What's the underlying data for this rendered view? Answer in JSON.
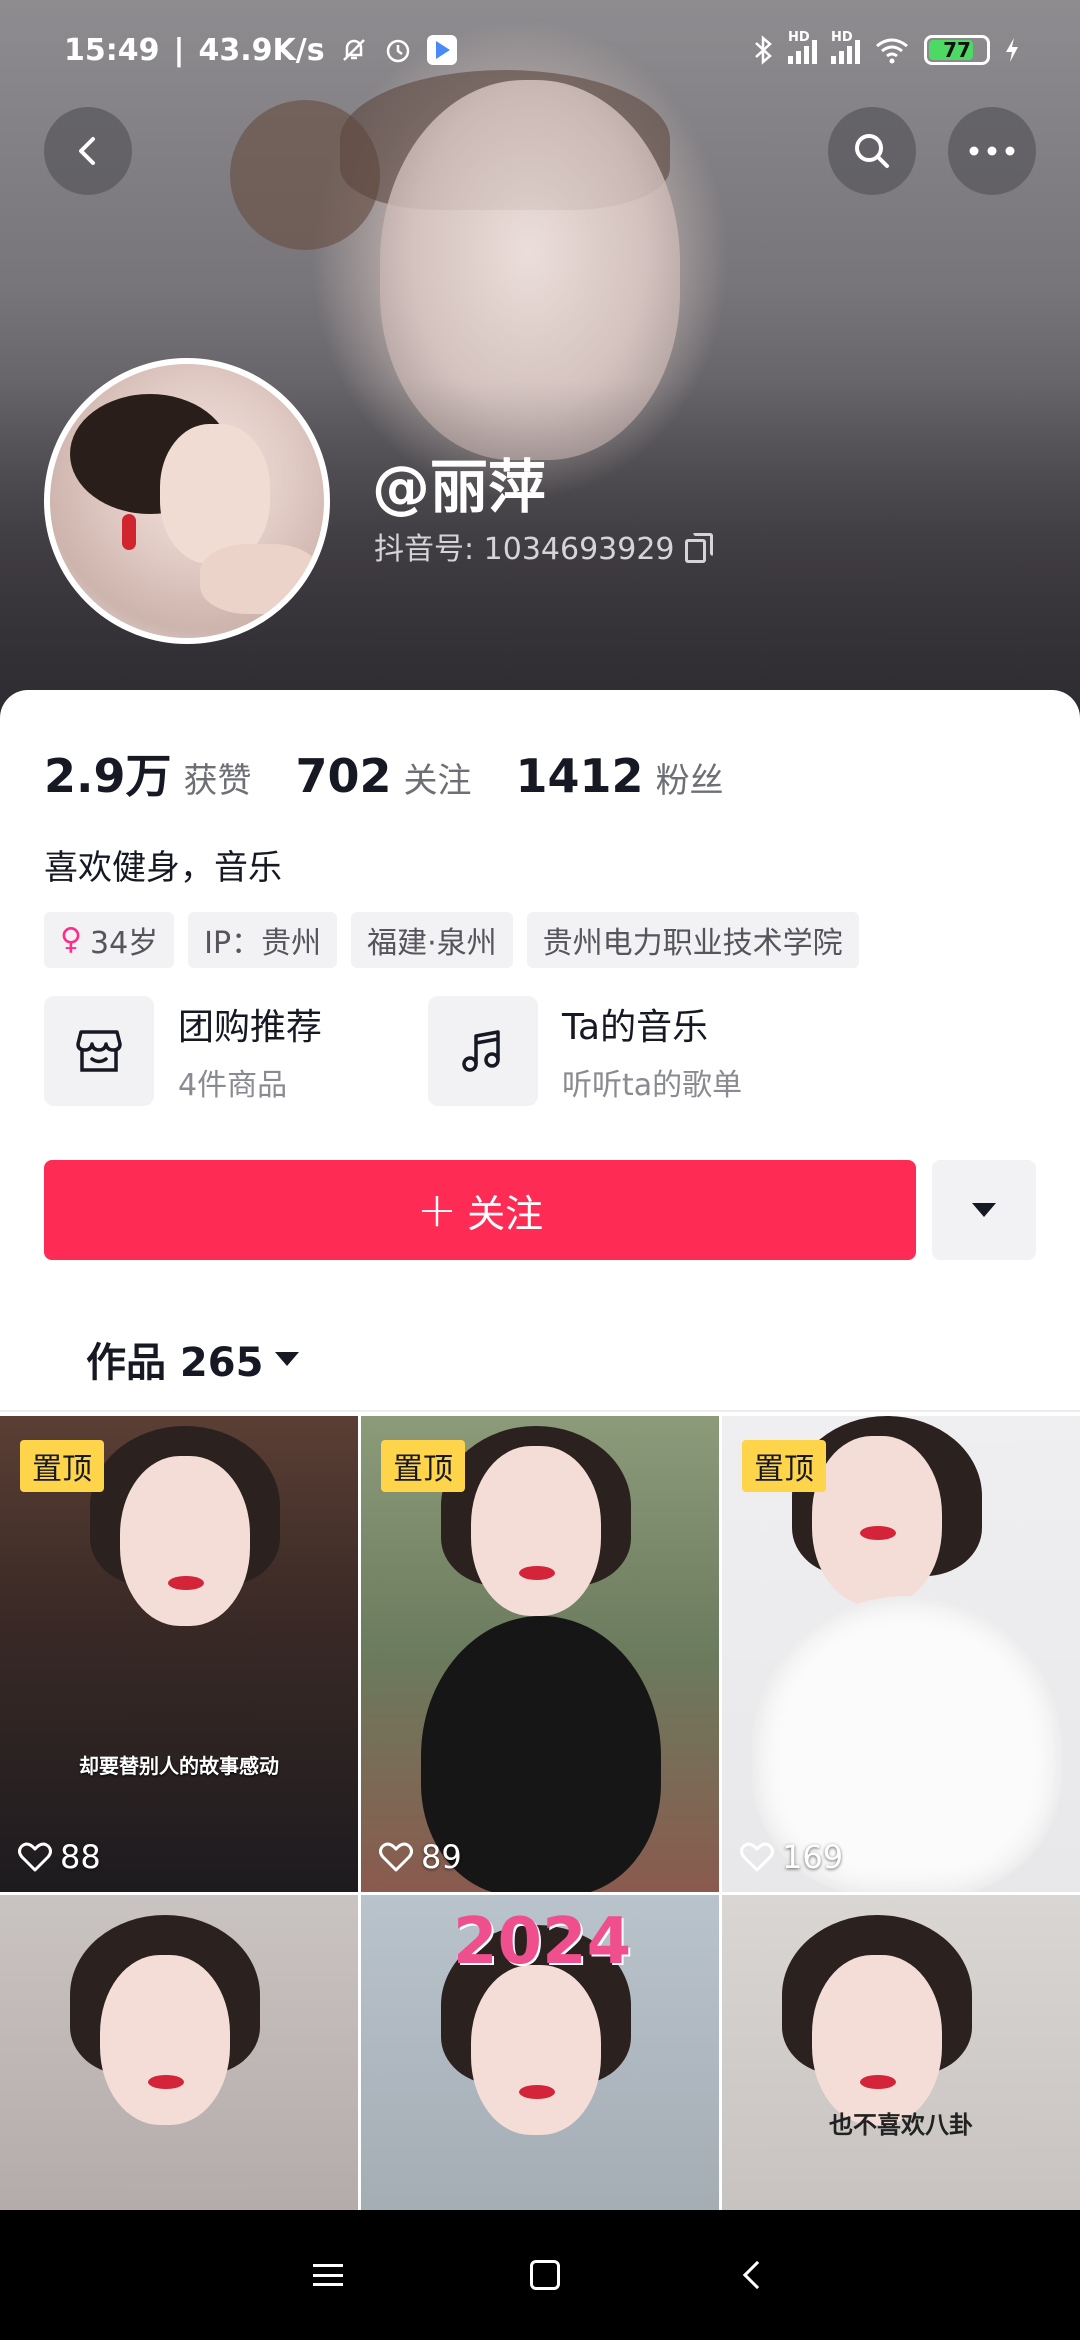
{
  "status_bar": {
    "time": "15:49",
    "net_speed": "43.9K/s",
    "battery": "77",
    "signal_label_1": "HD",
    "signal_label_2": "HD"
  },
  "profile": {
    "username": "@丽萍",
    "douyin_id": "抖音号: 1034693929"
  },
  "stats": [
    {
      "value": "2.9万",
      "label": "获赞"
    },
    {
      "value": "702",
      "label": "关注"
    },
    {
      "value": "1412",
      "label": "粉丝"
    }
  ],
  "bio": "喜欢健身，音乐",
  "tags": {
    "age": "34岁",
    "ip": "IP：贵州",
    "location": "福建·泉州",
    "school": "贵州电力职业技术学院"
  },
  "shortcuts": [
    {
      "title": "团购推荐",
      "subtitle": "4件商品",
      "icon": "shop-icon"
    },
    {
      "title": "Ta的音乐",
      "subtitle": "听听ta的歌单",
      "icon": "music-note-icon"
    }
  ],
  "follow_button": {
    "plus": "+",
    "label": "关注"
  },
  "works_tab": {
    "label": "作品 265"
  },
  "videos": [
    {
      "pinned_label": "置顶",
      "likes": "88",
      "caption": "却要替别人的故事感动"
    },
    {
      "pinned_label": "置顶",
      "likes": "89"
    },
    {
      "pinned_label": "置顶",
      "likes": "169"
    },
    {},
    {
      "overlay_text": "2024"
    },
    {
      "caption": "也不喜欢八卦"
    }
  ],
  "colors": {
    "accent": "#fe2c55",
    "pin_badge": "#fdd44a",
    "female_icon": "#fe2c8b"
  }
}
